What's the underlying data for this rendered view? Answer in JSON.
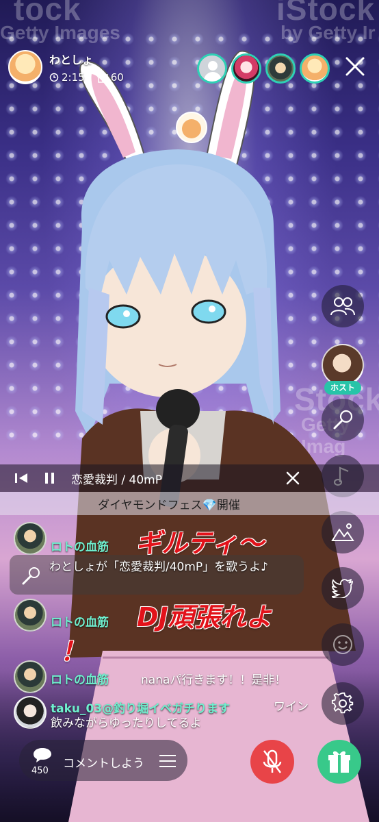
{
  "watermarks": {
    "top_left": "tock",
    "top_left_sub": "Getty Images",
    "top_right": "iStock",
    "top_right_sub": "by Getty Ir",
    "mid_right": "Stock",
    "mid_right_sub": "Getty Imag"
  },
  "host": {
    "name": "わとしょ",
    "duration": "2:15",
    "gift_count": "60"
  },
  "viewers": [
    "viewer-1",
    "viewer-2",
    "viewer-3",
    "viewer-4"
  ],
  "right_toolbar": {
    "host_tag": "ホスト",
    "icons": [
      "people-icon",
      "host-avatar",
      "microphone-icon",
      "music-note-icon",
      "mountain-icon",
      "twitter-icon",
      "smile-icon",
      "gear-icon"
    ]
  },
  "music": {
    "title": "恋愛裁判 / 40mP"
  },
  "banner": {
    "text": "ダイヤモンドフェス💎開催"
  },
  "overlays": {
    "line1": "ギルティ〜",
    "line2": "DJ頑張れよ",
    "line3": "！"
  },
  "chat": [
    {
      "name": "ロトの血筋",
      "text": ""
    },
    {
      "system": "わとしょが「恋愛裁判/40mP」を歌うよ♪"
    },
    {
      "name": "ロトの血筋",
      "text": ""
    },
    {
      "name": "ロトの血筋",
      "text": "nanaパ行きます！！是非！"
    },
    {
      "name": "taku_03@釣り堀イベガチります",
      "text": "ワイン飲みながらゆったりしてるよ"
    }
  ],
  "bottom": {
    "comment_count": "450",
    "comment_placeholder": "コメントしよう"
  },
  "colors": {
    "accent_teal": "#2fd0b5",
    "chat_name": "#6ff0cf",
    "mic_red": "#e84448",
    "gift_green": "#38c98a",
    "overlay_red": "#e2121a"
  }
}
